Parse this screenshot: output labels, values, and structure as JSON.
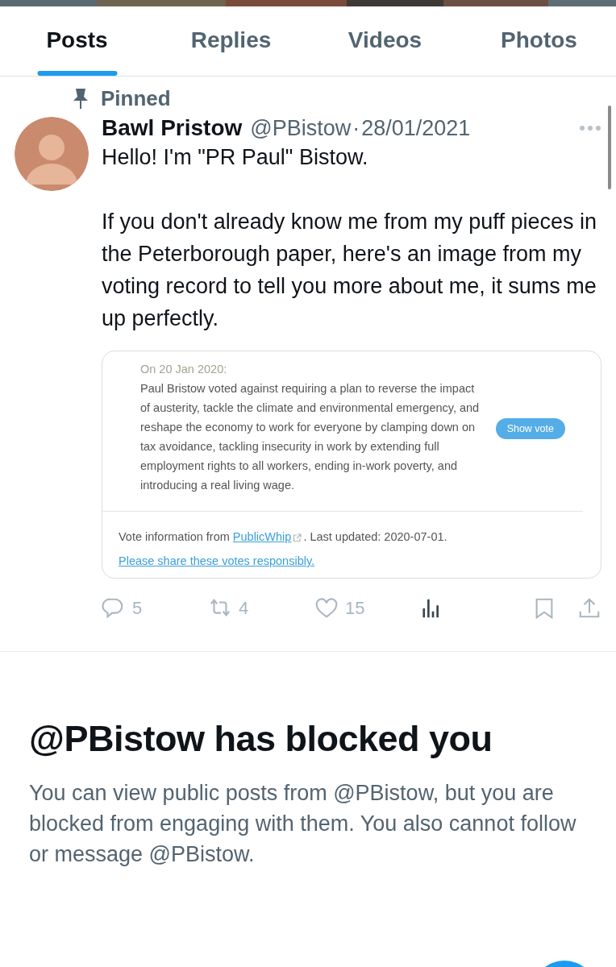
{
  "tabs": [
    {
      "label": "Posts",
      "selected": true
    },
    {
      "label": "Replies",
      "selected": false
    },
    {
      "label": "Videos",
      "selected": false
    },
    {
      "label": "Photos",
      "selected": false
    }
  ],
  "post": {
    "pinned_label": "Pinned",
    "author": "Bawl Pristow",
    "handle": "@PBistow",
    "separator": "·",
    "date": "28/01/2021",
    "paragraphs": [
      "Hello! I'm \"PR Paul\" Bistow.",
      "If you don't already know me from my puff pieces in the Peterborough paper, here's an image from my voting record to tell you more about me, it sums me up perfectly."
    ],
    "card": {
      "date": "On 20 Jan 2020:",
      "summary": "Paul Bristow voted against requiring a plan to reverse the impact of austerity, tackle the climate and environmental emergency, and reshape the economy to work for everyone by clamping down on tax avoidance, tackling insecurity in work by extending full employment rights to all workers, ending in-work poverty, and introducing a real living wage.",
      "button": "Show vote",
      "footer": [
        {
          "kind": "text",
          "text": "Vote information from "
        },
        {
          "kind": "link",
          "text": "PublicWhip",
          "external": true
        },
        {
          "kind": "text",
          "text": ". Last updated: 2020-07-01. "
        },
        {
          "kind": "link",
          "text": "Please share these votes responsibly.",
          "external": false
        }
      ]
    },
    "actions": [
      {
        "kind": "reply",
        "count": "5"
      },
      {
        "kind": "repost",
        "count": "4"
      },
      {
        "kind": "like",
        "count": "15"
      },
      {
        "kind": "views"
      },
      {
        "kind": "bookmark"
      },
      {
        "kind": "share"
      }
    ]
  },
  "blocked": {
    "title": "@PBistow has blocked you",
    "message": "You can view public posts from @PBistow, but you are blocked from engaging with them. You also cannot follow or message @PBistow."
  }
}
